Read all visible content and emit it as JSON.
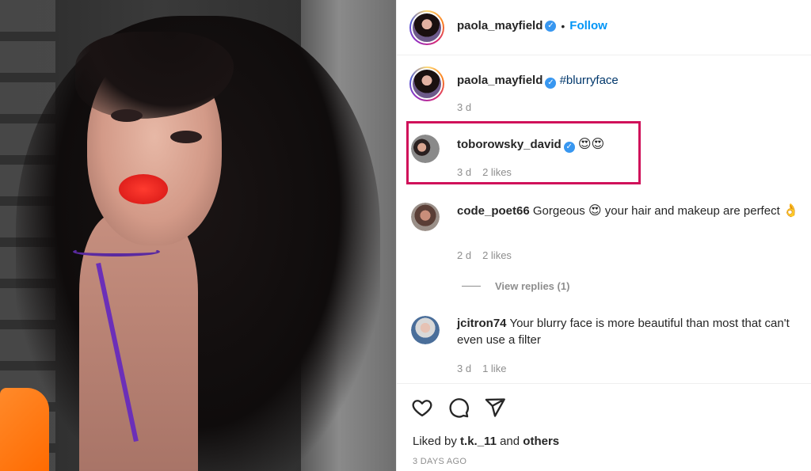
{
  "header": {
    "username": "paola_mayfield",
    "dot": "•",
    "follow_label": "Follow"
  },
  "caption": {
    "username": "paola_mayfield",
    "text": "#blurryface",
    "time": "3 d"
  },
  "comments": [
    {
      "username": "toborowsky_david",
      "verified": true,
      "text": "😍😍",
      "time": "3 d",
      "likes": "2 likes",
      "highlighted": true
    },
    {
      "username": "code_poet66",
      "verified": false,
      "text_a": "Gorgeous",
      "emoji_a": "😍",
      "text_b": "your hair and makeup are perfect",
      "emoji_b": "👌",
      "time": "2 d",
      "likes": "2 likes",
      "view_replies": "View replies (1)"
    },
    {
      "username": "jcitron74",
      "verified": false,
      "text": "Your blurry face is more beautiful than most that can't even use a filter",
      "time": "3 d",
      "likes": "1 like"
    }
  ],
  "footer": {
    "liked_prefix": "Liked by",
    "liked_user": "t.k._11",
    "liked_and": "and",
    "liked_others": "others",
    "date": "3 DAYS AGO"
  },
  "icons": {
    "verified": "verified-badge-icon",
    "like": "heart-icon",
    "comment": "comment-bubble-icon",
    "share": "paper-plane-icon"
  },
  "colors": {
    "follow": "#0095f6",
    "verified": "#3897f0",
    "highlight_box": "#d0115a",
    "hashtag": "#00376b"
  }
}
